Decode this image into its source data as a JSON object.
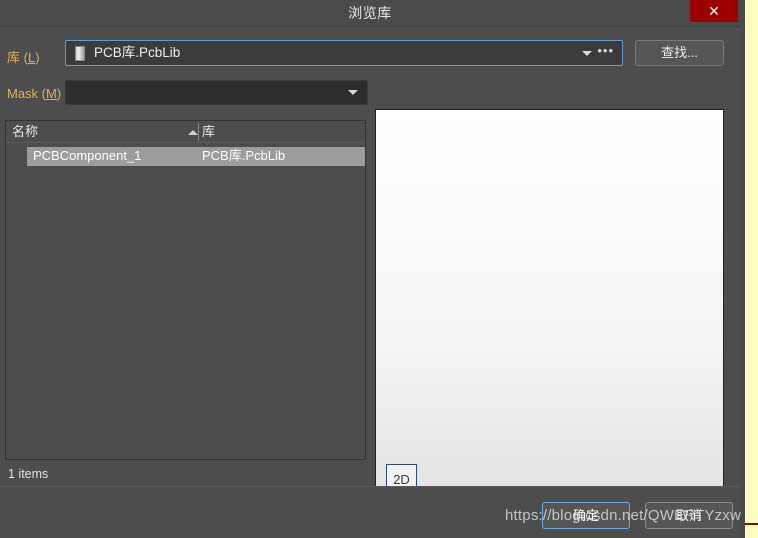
{
  "window": {
    "title": "浏览库",
    "close_label": "✕"
  },
  "library_row": {
    "label_prefix": "库 (",
    "label_mnemonic": "L",
    "label_suffix": ")",
    "value": "PCB库.PcbLib",
    "chip_icon": "ic-chip-icon",
    "dropdown_icon": "chevron-down-icon",
    "ellipsis_icon": "ellipsis-icon",
    "ellipsis_label": "•••",
    "search_button": "查找..."
  },
  "mask_row": {
    "label_prefix": "Mask (",
    "label_mnemonic": "M",
    "label_suffix": ")",
    "value": "",
    "placeholder": "",
    "dropdown_icon": "chevron-down-icon"
  },
  "list": {
    "columns": [
      {
        "key": "name",
        "label": "名称",
        "sorted": "asc"
      },
      {
        "key": "library",
        "label": "库",
        "sorted": "none"
      }
    ],
    "sort_icon": "sort-ascending-icon",
    "rows": [
      {
        "name": "PCBComponent_1",
        "library": "PCB库.PcbLib",
        "selected": true
      }
    ],
    "status": "1 items"
  },
  "preview": {
    "view_mode_label": "2D"
  },
  "footer": {
    "ok_label": "确定",
    "cancel_label": "取消"
  },
  "overlay": {
    "watermark": "https://blog.csdn.net/QWERTYzxw"
  },
  "colors": {
    "window_bg": "#4d4d4d",
    "titlebar_bg": "#4a4a4a",
    "close_red": "#9c0000",
    "label_orange": "#e0b060",
    "focus_blue": "#5f9fd0",
    "row_selected": "#9c9c9c",
    "page_yellow": "#fdfdc0"
  }
}
